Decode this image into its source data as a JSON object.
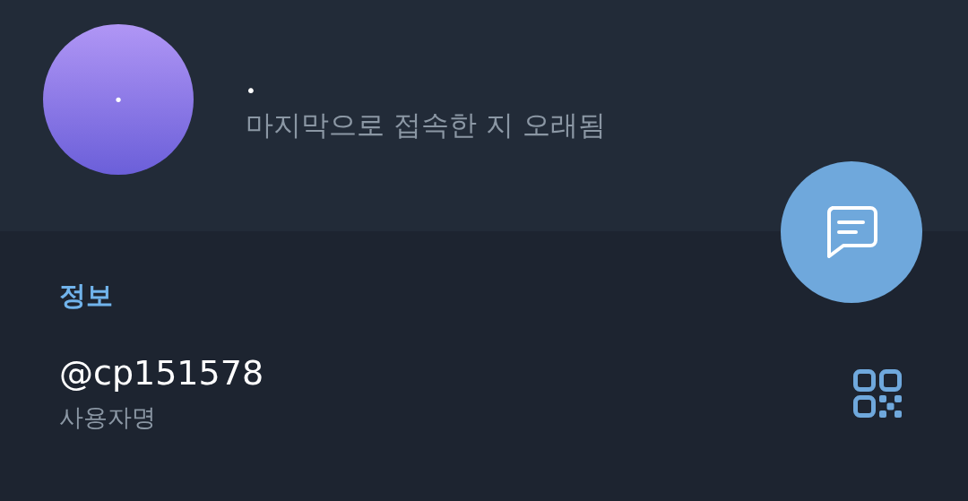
{
  "profile": {
    "avatar_initial": "•",
    "name": "•",
    "status": "마지막으로 접속한 지 오래됨"
  },
  "info": {
    "title": "정보",
    "username": "@cp151578",
    "username_label": "사용자명"
  }
}
